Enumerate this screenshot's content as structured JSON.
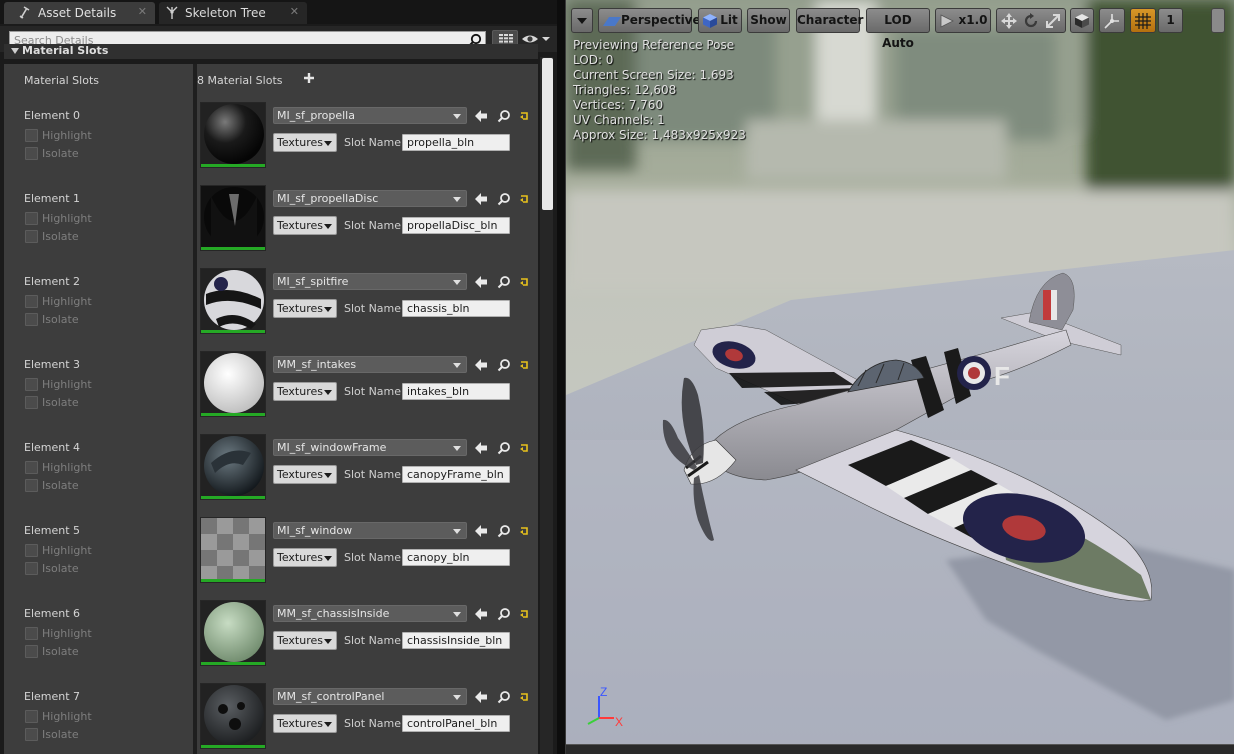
{
  "tabs": {
    "asset_details": "Asset Details",
    "skeleton_tree": "Skeleton Tree"
  },
  "search": {
    "placeholder": "Search Details"
  },
  "category": {
    "title": "Material Slots"
  },
  "material_slots": {
    "header_label": "Material Slots",
    "count_label": "8 Material Slots",
    "highlight_label": "Highlight",
    "isolate_label": "Isolate",
    "textures_label": "Textures",
    "slot_name_label": "Slot Name",
    "elements": [
      {
        "label": "Element 0",
        "material": "MI_sf_propella",
        "slot_name": "propella_bln"
      },
      {
        "label": "Element 1",
        "material": "MI_sf_propellaDisc",
        "slot_name": "propellaDisc_bln"
      },
      {
        "label": "Element 2",
        "material": "MI_sf_spitfire",
        "slot_name": "chassis_bln"
      },
      {
        "label": "Element 3",
        "material": "MM_sf_intakes",
        "slot_name": "intakes_bln"
      },
      {
        "label": "Element 4",
        "material": "MI_sf_windowFrame",
        "slot_name": "canopyFrame_bln"
      },
      {
        "label": "Element 5",
        "material": "MI_sf_window",
        "slot_name": "canopy_bln"
      },
      {
        "label": "Element 6",
        "material": "MM_sf_chassisInside",
        "slot_name": "chassisInside_bln"
      },
      {
        "label": "Element 7",
        "material": "MM_sf_controlPanel",
        "slot_name": "controlPanel_bln"
      }
    ]
  },
  "viewport": {
    "toolbar": {
      "perspective": "Perspective",
      "lit": "Lit",
      "show": "Show",
      "character": "Character",
      "lod": "LOD Auto",
      "speed": "x1.0",
      "camera_speed": "1"
    },
    "stats": {
      "line1": "Previewing Reference Pose",
      "line2": "LOD: 0",
      "line3": "Current Screen Size: 1.693",
      "line4": "Triangles: 12,608",
      "line5": "Vertices: 7,760",
      "line6": "UV Channels: 1",
      "line7": "Approx Size: 1,483x925x923"
    },
    "axes": {
      "z": "Z",
      "x": "X"
    }
  },
  "colors": {
    "accent_green": "#25a925",
    "reset_yellow": "#e8c21c",
    "grid_active": "#c98319"
  }
}
